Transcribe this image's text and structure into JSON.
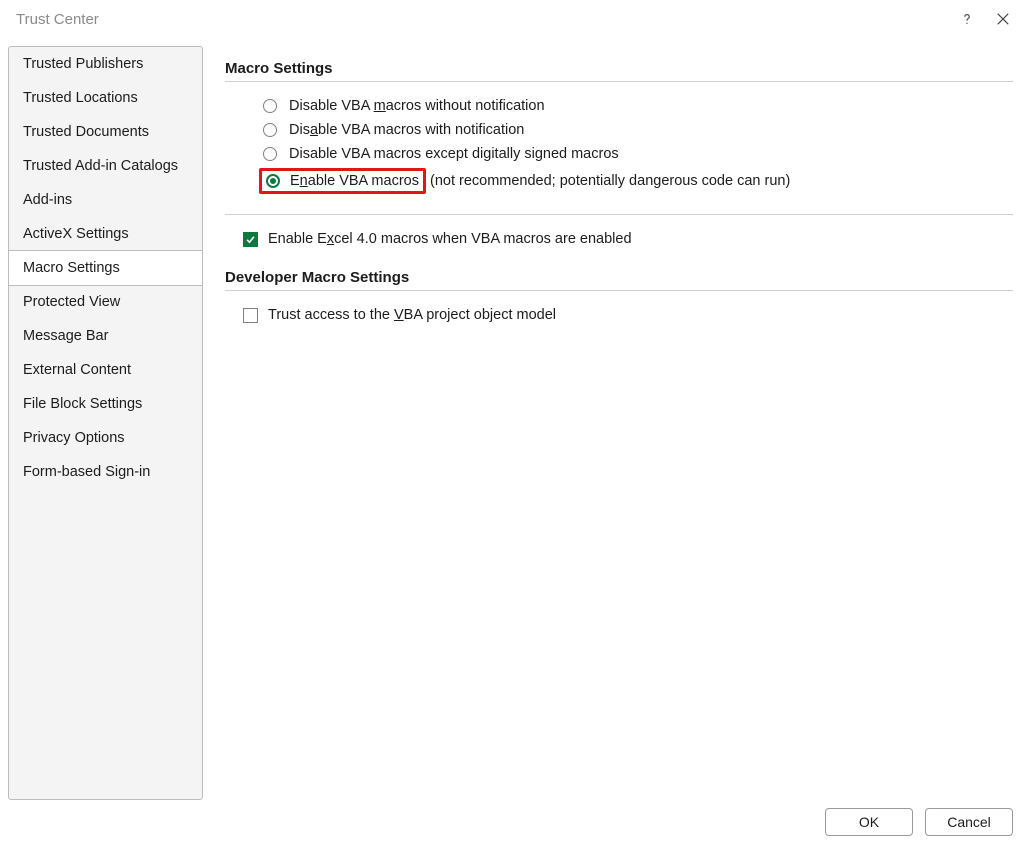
{
  "titlebar": {
    "title": "Trust Center"
  },
  "sidebar": {
    "items": [
      {
        "label": "Trusted Publishers"
      },
      {
        "label": "Trusted Locations"
      },
      {
        "label": "Trusted Documents"
      },
      {
        "label": "Trusted Add-in Catalogs"
      },
      {
        "label": "Add-ins"
      },
      {
        "label": "ActiveX Settings"
      },
      {
        "label": "Macro Settings",
        "selected": true
      },
      {
        "label": "Protected View"
      },
      {
        "label": "Message Bar"
      },
      {
        "label": "External Content"
      },
      {
        "label": "File Block Settings"
      },
      {
        "label": "Privacy Options"
      },
      {
        "label": "Form-based Sign-in"
      }
    ]
  },
  "section": {
    "macro_title": "Macro Settings",
    "options": {
      "opt1_pre": "Disable VBA ",
      "opt1_mn": "m",
      "opt1_post": "acros without notification",
      "opt2_pre": "Dis",
      "opt2_mn": "a",
      "opt2_post": "ble VBA macros with notification",
      "opt3_pre": "Disable VBA macros except di",
      "opt3_mn": "g",
      "opt3_post": "itally signed macros",
      "opt4_pre": "E",
      "opt4_mn": "n",
      "opt4_post": "able VBA macros",
      "opt4_suffix": " (not recommended; potentially dangerous code can run)",
      "selected": 3
    },
    "excel4_pre": "Enable E",
    "excel4_mn": "x",
    "excel4_post": "cel 4.0 macros when VBA macros are enabled",
    "excel4_checked": true,
    "dev_title": "Developer Macro Settings",
    "trust_pre": "Trust access to the ",
    "trust_mn": "V",
    "trust_post": "BA project object model",
    "trust_checked": false
  },
  "footer": {
    "ok": "OK",
    "cancel": "Cancel"
  }
}
